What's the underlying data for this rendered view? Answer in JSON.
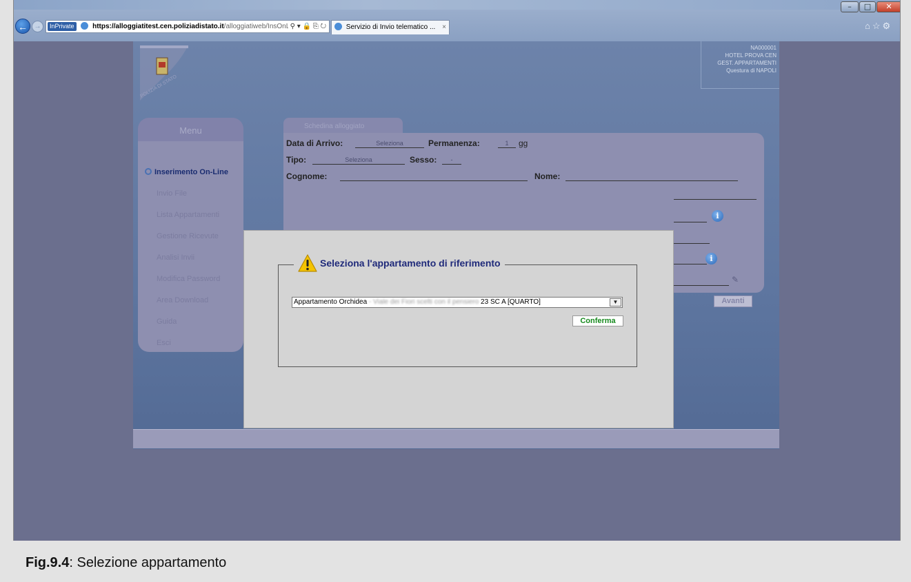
{
  "browser": {
    "inprivate_label": "InPrivate",
    "url_host": "https://alloggiatitest.cen.poliziadistato.it",
    "url_path": "/alloggiatiweb/InsOnLine.a",
    "tab_title": "Servizio di Invio telematico ...",
    "tab_close": "×"
  },
  "header": {
    "lines": [
      "NA000001",
      "HOTEL PROVA CEN",
      "GEST. APPARTAMENTI",
      "Questura di NAPOLI"
    ]
  },
  "menu": {
    "title": "Menu",
    "items": [
      {
        "label": "Inserimento On-Line",
        "active": true
      },
      {
        "label": "Invio File"
      },
      {
        "label": "Lista Appartamenti"
      },
      {
        "label": "Gestione Ricevute"
      },
      {
        "label": "Analisi Invii"
      },
      {
        "label": "Modifica Password"
      },
      {
        "label": "Area Download"
      },
      {
        "label": "Guida"
      },
      {
        "label": "Esci"
      }
    ]
  },
  "form": {
    "tab_label": "Schedina alloggiato",
    "arrival_label": "Data di Arrivo:",
    "arrival_value": "Seleziona",
    "stay_label": "Permanenza:",
    "stay_value": "1",
    "stay_unit": "gg",
    "type_label": "Tipo:",
    "type_value": "Seleziona",
    "sex_label": "Sesso:",
    "sex_value": "-",
    "surname_label": "Cognome:",
    "name_label": "Nome:",
    "next_label": "Avanti"
  },
  "modal": {
    "legend": "Seleziona l'appartamento di riferimento",
    "select_value_prefix": "Appartamento Orchidea",
    "select_value_hidden": " - Viale dei Fiori scelti con il pensiero",
    "select_value_suffix": " 23 SC A [QUARTO]",
    "confirm_label": "Conferma"
  },
  "caption": {
    "figure": "Fig.9.4",
    "text": ": Selezione appartamento"
  },
  "colors": {
    "app_bg": "#5e76a0",
    "overlay_bg": "#6b6f8e",
    "modal_bg": "#d4d4d4",
    "legend_text": "#1f2a7a",
    "confirm_text": "#178a1e"
  }
}
